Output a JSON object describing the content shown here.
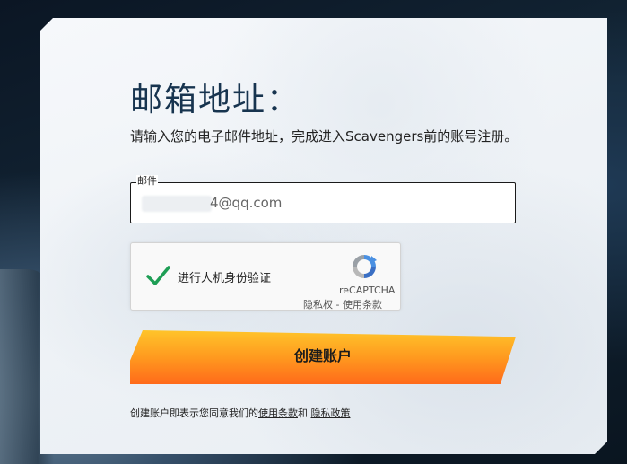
{
  "page": {
    "title": "邮箱地址：",
    "description": "请输入您的电子邮件地址，完成进入Scavengers前的账号注册。"
  },
  "email": {
    "legend": "邮件",
    "value": "4@qq.com",
    "value_prefix_hidden": "redacted"
  },
  "captcha": {
    "label": "进行人机身份验证",
    "brand": "reCAPTCHA",
    "privacy": "隐私权",
    "separator": " - ",
    "terms": "使用条款",
    "checked": true
  },
  "create_button": {
    "label": "创建账户"
  },
  "footer": {
    "prefix": "创建账户即表示您同意我们的",
    "terms_link": "使用条款",
    "and": "和 ",
    "privacy_link": "隐私政策"
  },
  "colors": {
    "title": "#17344f",
    "button_top": "#ffc42a",
    "button_bottom": "#ff6a1a",
    "check_green": "#1e9e55",
    "recaptcha_blue": "#4a90e2"
  }
}
